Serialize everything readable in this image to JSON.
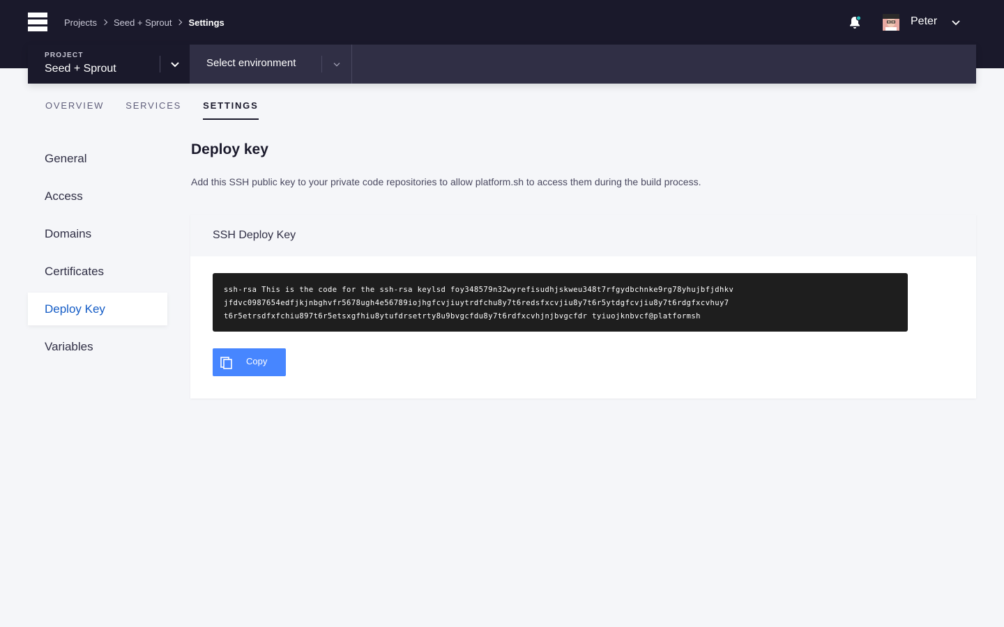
{
  "header": {
    "breadcrumbs": [
      "Projects",
      "Seed + Sprout",
      "Settings"
    ],
    "user": {
      "name": "Peter"
    }
  },
  "project_bar": {
    "project_label": "PROJECT",
    "project_name": "Seed + Sprout",
    "environment_placeholder": "Select environment"
  },
  "tabs": [
    {
      "label": "OVERVIEW",
      "active": false
    },
    {
      "label": "SERVICES",
      "active": false
    },
    {
      "label": "SETTINGS",
      "active": true
    }
  ],
  "sidebar": {
    "items": [
      {
        "label": "General",
        "active": false
      },
      {
        "label": "Access",
        "active": false
      },
      {
        "label": "Domains",
        "active": false
      },
      {
        "label": "Certificates",
        "active": false
      },
      {
        "label": "Deploy Key",
        "active": true
      },
      {
        "label": "Variables",
        "active": false
      }
    ]
  },
  "main": {
    "title": "Deploy key",
    "description": "Add this SSH public key to your private code repositories to allow platform.sh to access them during the build process.",
    "card": {
      "title": "SSH Deploy Key",
      "key_lines": [
        "ssh-rsa This is the code for the ssh-rsa keylsd foy348579n32wyrefisudhjskweu348t7rfgydbchnke9rg78yhujbfjdhkv",
        "jfdvc0987654edfjkjnbghvfr5678ugh4e56789iojhgfcvjiuytrdfchu8y7t6redsfxcvjiu8y7t6r5ytdgfcvjiu8y7t6rdgfxcvhuy7",
        "t6r5etrsdfxfchiu897t6r5etsxgfhiu8ytufdrsetrty8u9bvgcfdu8y7t6rdfxcvhjnjbvgcfdr tyiuojknbvcf@platformsh"
      ],
      "copy_label": "Copy"
    }
  },
  "colors": {
    "header_bg": "#1a192b",
    "project_bar_bg": "#302f45",
    "accent": "#4786ff",
    "active_link": "#145cc6",
    "notification_dot": "#23b7b7"
  }
}
